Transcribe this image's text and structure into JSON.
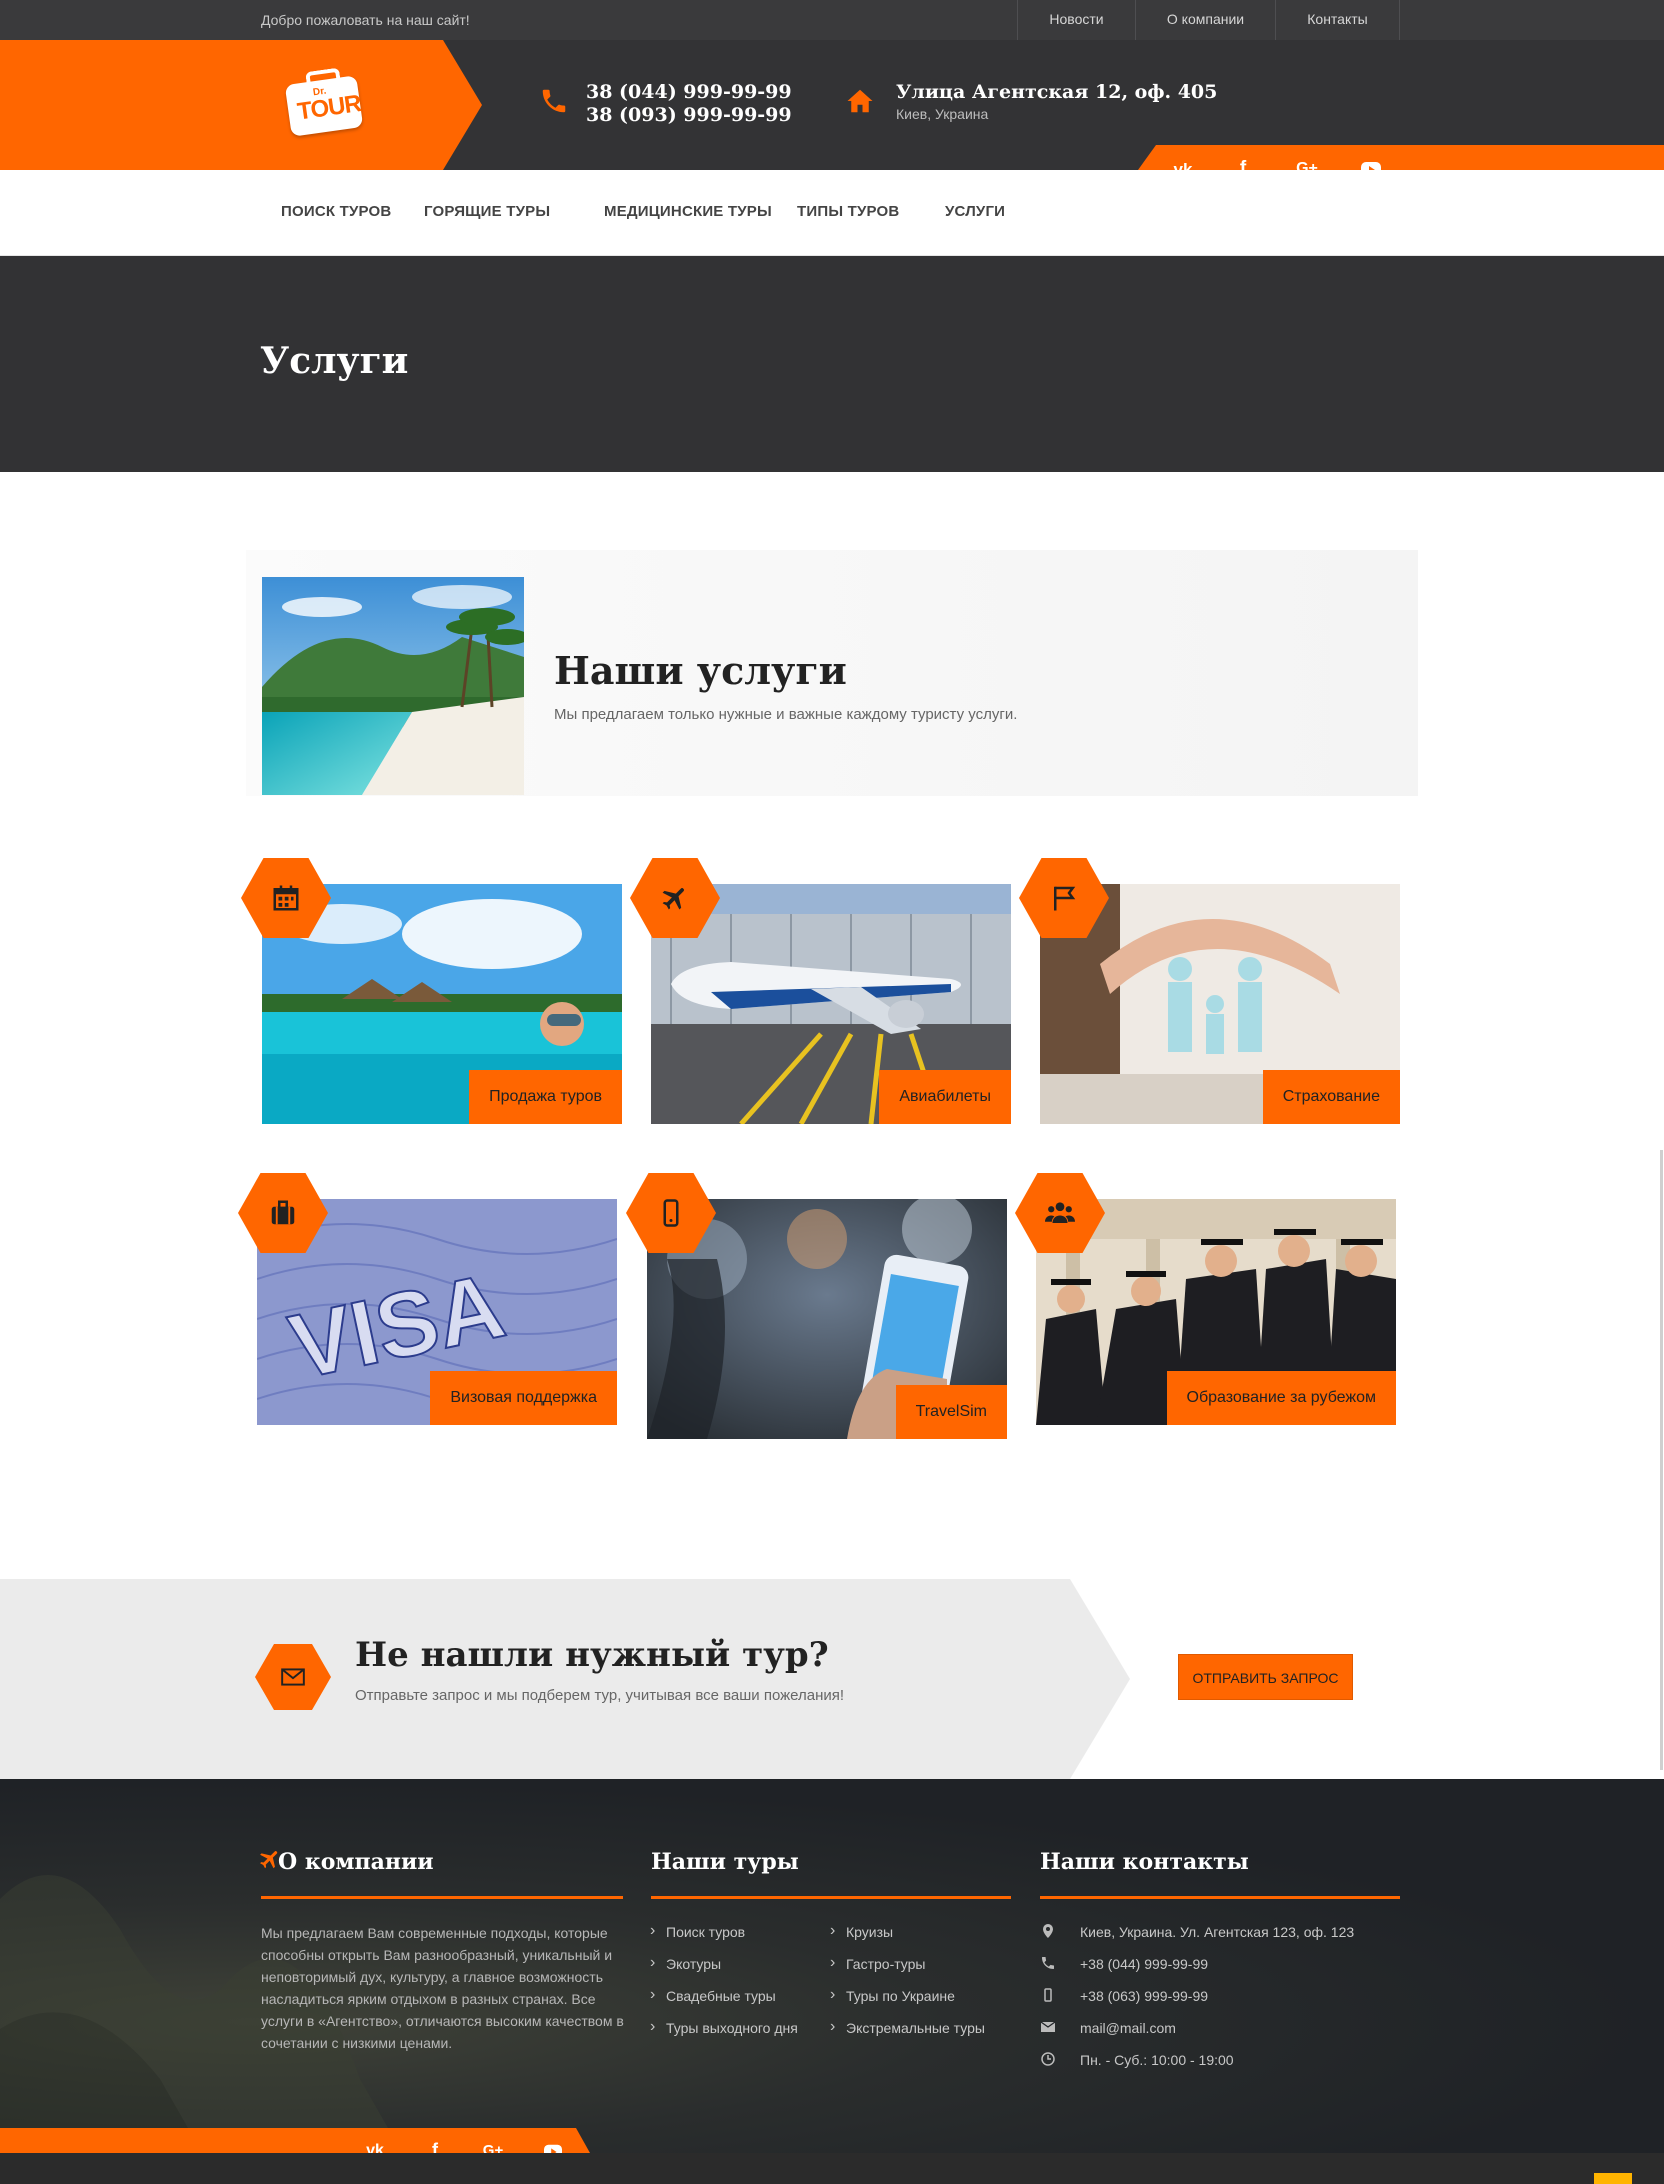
{
  "topbar": {
    "welcome": "Добро пожаловать на наш сайт!",
    "links": [
      "Новости",
      "О компании",
      "Контакты"
    ]
  },
  "header": {
    "logo_small": "Dr.",
    "logo_big": "TOUR",
    "phone1": "38 (044) 999-99-99",
    "phone2": "38 (093) 999-99-99",
    "address": "Улица Агентская 12, оф. 405",
    "city": "Киев, Украина",
    "social": [
      "vk",
      "f",
      "G+",
      "youtube"
    ]
  },
  "nav": [
    "ПОИСК ТУРОВ",
    "ГОРЯЩИЕ ТУРЫ",
    "МЕДИЦИНСКИЕ ТУРЫ",
    "ТИПЫ ТУРОВ",
    "УСЛУГИ"
  ],
  "page_title": "Услуги",
  "intro": {
    "heading": "Наши услуги",
    "text": "Мы предлагаем только нужные и важные каждому туристу услуги."
  },
  "services": [
    {
      "label": "Продажа туров",
      "icon": "calendar-icon"
    },
    {
      "label": "Авиабилеты",
      "icon": "plane-icon"
    },
    {
      "label": "Страхование",
      "icon": "flag-icon"
    },
    {
      "label": "Визовая поддержка",
      "icon": "suitcase-icon"
    },
    {
      "label": "TravelSim",
      "icon": "mobile-icon"
    },
    {
      "label": "Образование за рубежом",
      "icon": "users-icon"
    }
  ],
  "cta": {
    "heading": "Не нашли нужный тур?",
    "text": "Отправьте запрос и мы подберем тур, учитывая все ваши пожелания!",
    "button": "ОТПРАВИТЬ ЗАПРОС"
  },
  "footer": {
    "about_title": "О компании",
    "about_text": "Мы предлагаем Вам современные подходы, которые способны открыть Вам разнообразный, уникальный и неповторимый дух, культуру, а главное возможность насладиться ярким отдыхом в разных странах. Все услуги в «Агентство», отличаются высоким качеством в сочетании с низкими ценами.",
    "tours_title": "Наши туры",
    "tours_col1": [
      "Поиск туров",
      "Экотуры",
      "Свадебные туры",
      "Туры выходного дня"
    ],
    "tours_col2": [
      "Круизы",
      "Гастро-туры",
      "Туры по Украине",
      "Экстремальные туры"
    ],
    "contacts_title": "Наши контакты",
    "contacts": [
      {
        "icon": "map-marker-icon",
        "text": "Киев, Украина. Ул. Агентская 123, оф. 123"
      },
      {
        "icon": "phone-icon",
        "text": "+38 (044) 999-99-99"
      },
      {
        "icon": "mobile-icon",
        "text": "+38 (063) 999-99-99"
      },
      {
        "icon": "envelope-icon",
        "text": "mail@mail.com"
      },
      {
        "icon": "clock-icon",
        "text": "Пн. - Суб.: 10:00 - 19:00"
      }
    ]
  },
  "colors": {
    "accent": "#ff6600",
    "dark": "#323234",
    "footer": "#1f2226"
  }
}
